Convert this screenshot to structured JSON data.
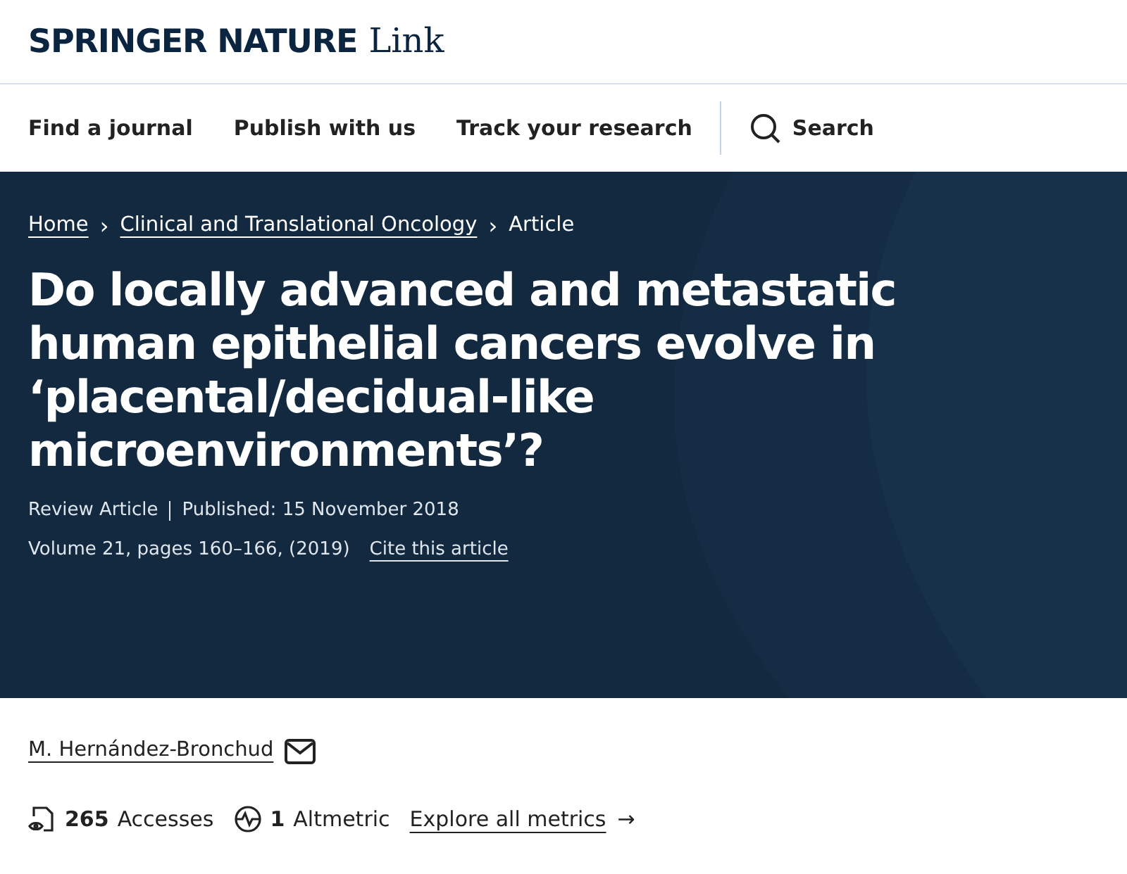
{
  "logo": {
    "brand": "SPRINGER NATURE",
    "product": "Link"
  },
  "nav": [
    {
      "label": "Find a journal"
    },
    {
      "label": "Publish with us"
    },
    {
      "label": "Track your research"
    }
  ],
  "search": {
    "label": "Search"
  },
  "breadcrumbs": [
    {
      "label": "Home",
      "kind": "link"
    },
    {
      "label": "Clinical and Translational Oncology",
      "kind": "link"
    },
    {
      "label": "Article",
      "kind": "current"
    }
  ],
  "separator": "›",
  "title": "Do locally advanced and metastatic human epithelial cancers evolve in ‘placental/decidual-like microenvironments’?",
  "article_type": "Review Article",
  "published": "Published: 15 November 2018",
  "citation": "Volume 21, pages 160–166, (2019)",
  "cite_link": "Cite this article",
  "author": "M. Hernández-Bronchud",
  "metrics": [
    {
      "kind": "accesses",
      "value": "265",
      "label": "Accesses"
    },
    {
      "kind": "altmetric",
      "value": "1",
      "label": "Altmetric"
    }
  ],
  "explore_link": "Explore all metrics",
  "explore_arrow": "→"
}
